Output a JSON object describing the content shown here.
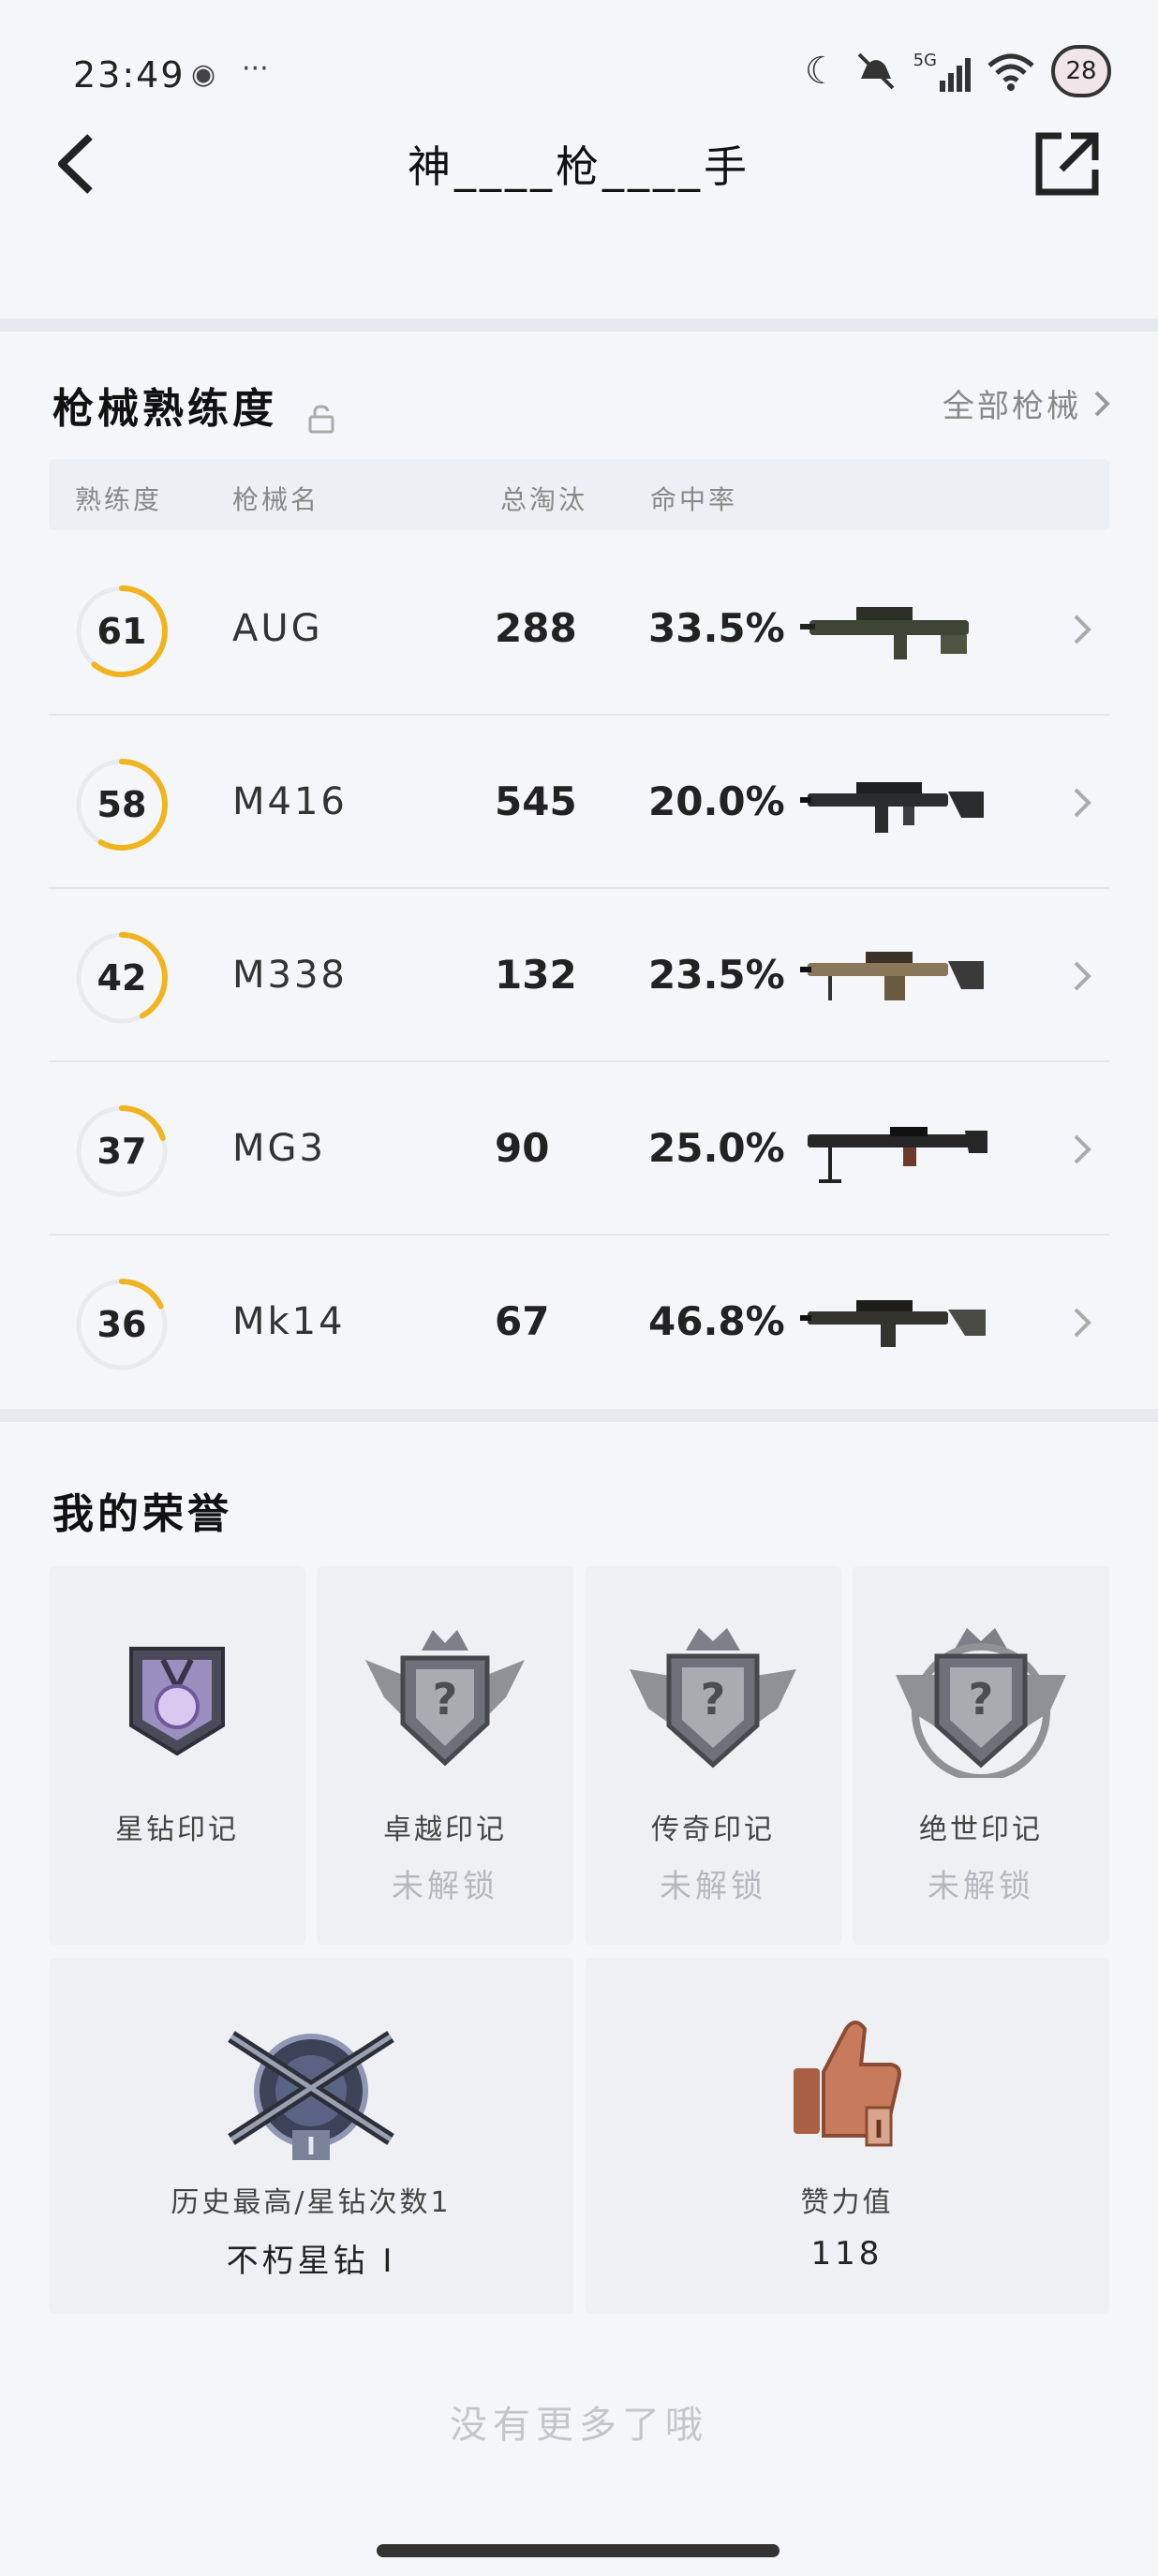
{
  "status_bar": {
    "time": "23:49",
    "icons": [
      "shield-icon",
      "more-dots-icon",
      "moon-icon",
      "mute-icon",
      "signal-5g-icon",
      "wifi-icon"
    ],
    "network": "5G",
    "battery": "28"
  },
  "nav": {
    "title": "神____枪____手",
    "back_icon": "back-arrow-icon",
    "share_icon": "share-icon"
  },
  "weapons": {
    "title": "枪械熟练度",
    "all_link": "全部枪械",
    "columns": [
      "熟练度",
      "枪械名",
      "总淘汰",
      "命中率"
    ],
    "rows": [
      {
        "proficiency": "61",
        "name": "AUG",
        "eliminations": "288",
        "accuracy": "33.5%",
        "progress": 0.61
      },
      {
        "proficiency": "58",
        "name": "M416",
        "eliminations": "545",
        "accuracy": "20.0%",
        "progress": 0.58
      },
      {
        "proficiency": "42",
        "name": "M338",
        "eliminations": "132",
        "accuracy": "23.5%",
        "progress": 0.42
      },
      {
        "proficiency": "37",
        "name": "MG3",
        "eliminations": "90",
        "accuracy": "25.0%",
        "progress": 0.2
      },
      {
        "proficiency": "36",
        "name": "Mk14",
        "eliminations": "67",
        "accuracy": "46.8%",
        "progress": 0.18
      }
    ]
  },
  "honors": {
    "title": "我的荣誉",
    "badges": [
      {
        "label": "星钻印记",
        "sub": ""
      },
      {
        "label": "卓越印记",
        "sub": "未解锁"
      },
      {
        "label": "传奇印记",
        "sub": "未解锁"
      },
      {
        "label": "绝世印记",
        "sub": "未解锁"
      }
    ],
    "rank": {
      "label": "历史最高/星钻次数1",
      "value": "不朽星钻 I"
    },
    "likes": {
      "label": "赞力值",
      "value": "118"
    }
  },
  "footer": "没有更多了哦",
  "colors": {
    "accent": "#f2b41e",
    "ring_track": "#e8eaee"
  }
}
